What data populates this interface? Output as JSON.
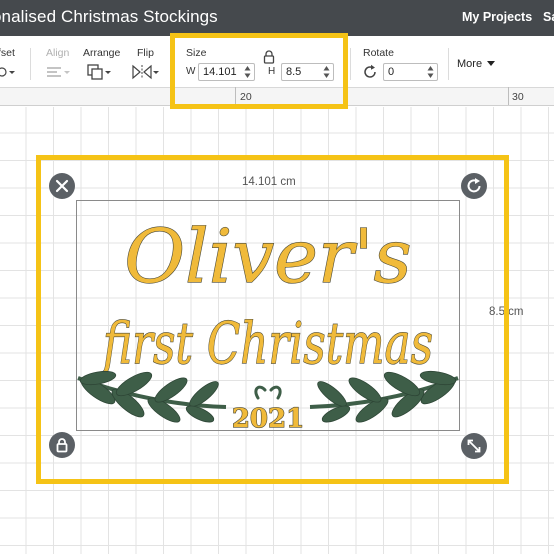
{
  "window": {
    "title": "onalised Christmas Stockings",
    "my_projects": "My Projects",
    "save_truncated": "Sa"
  },
  "toolbar": {
    "offset_label": "fset",
    "align_label": "Align",
    "arrange_label": "Arrange",
    "flip_label": "Flip",
    "size": {
      "label": "Size",
      "w_label": "W",
      "w_value": "14.101",
      "h_label": "H",
      "h_value": "8.5"
    },
    "rotate": {
      "label": "Rotate",
      "value": "0"
    },
    "more_label": "More"
  },
  "ruler": {
    "ticks": [
      "20",
      "30"
    ]
  },
  "canvas": {
    "width_dimension": "14.101 cm",
    "height_dimension": "8.5 cm"
  },
  "design": {
    "line1": "Oliver's",
    "line2": "first Christmas",
    "year": "2021"
  },
  "colors": {
    "highlight": "#f5c316",
    "title_bar": "#45494d",
    "lettering": "#f0ba3a",
    "leaves": "#3e5e48",
    "handle": "#5b6065"
  },
  "icons": {
    "delete": "close-icon",
    "rotate": "rotate-icon",
    "lock": "lock-icon",
    "resize": "resize-icon"
  }
}
